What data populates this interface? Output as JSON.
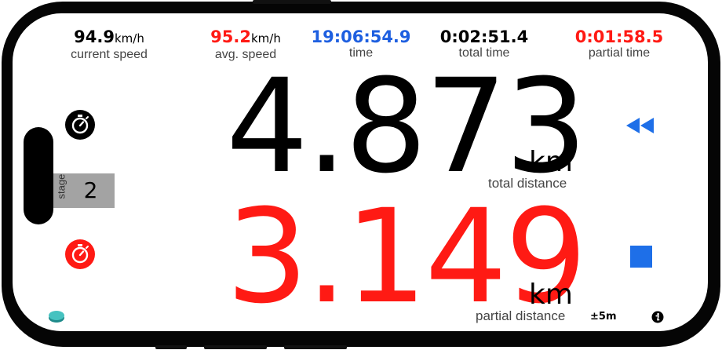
{
  "stats": [
    {
      "value": "94.9",
      "unit": "km/h",
      "label": "current speed",
      "color": "#000000"
    },
    {
      "value": "95.2",
      "unit": "km/h",
      "label": "avg. speed",
      "color": "#ff1a14"
    },
    {
      "value": "19:06:54.9",
      "unit": "",
      "label": "time",
      "color": "#1e5fe0"
    },
    {
      "value": "0:02:51.4",
      "unit": "",
      "label": "total time",
      "color": "#000000"
    },
    {
      "value": "0:01:58.5",
      "unit": "",
      "label": "partial time",
      "color": "#ff1a14"
    }
  ],
  "total_distance": {
    "value": "4.873",
    "unit": "km",
    "label": "total distance",
    "color": "#000000"
  },
  "partial_distance": {
    "value": "3.149",
    "unit": "km",
    "label": "partial distance",
    "color": "#ff1a14"
  },
  "stage": {
    "label": "stage",
    "number": "2"
  },
  "accuracy": "±5m",
  "icons": {
    "stopwatch_top": "stopwatch-icon",
    "stopwatch_bottom": "stopwatch-reset-icon",
    "rewind": "rewind-icon",
    "stop": "stop-icon",
    "info": "info-icon",
    "theme": "theme-toggle-icon"
  },
  "colors": {
    "accent_blue": "#1e6fe8",
    "red": "#ff1a14",
    "stage_bg": "#a3a3a3"
  }
}
